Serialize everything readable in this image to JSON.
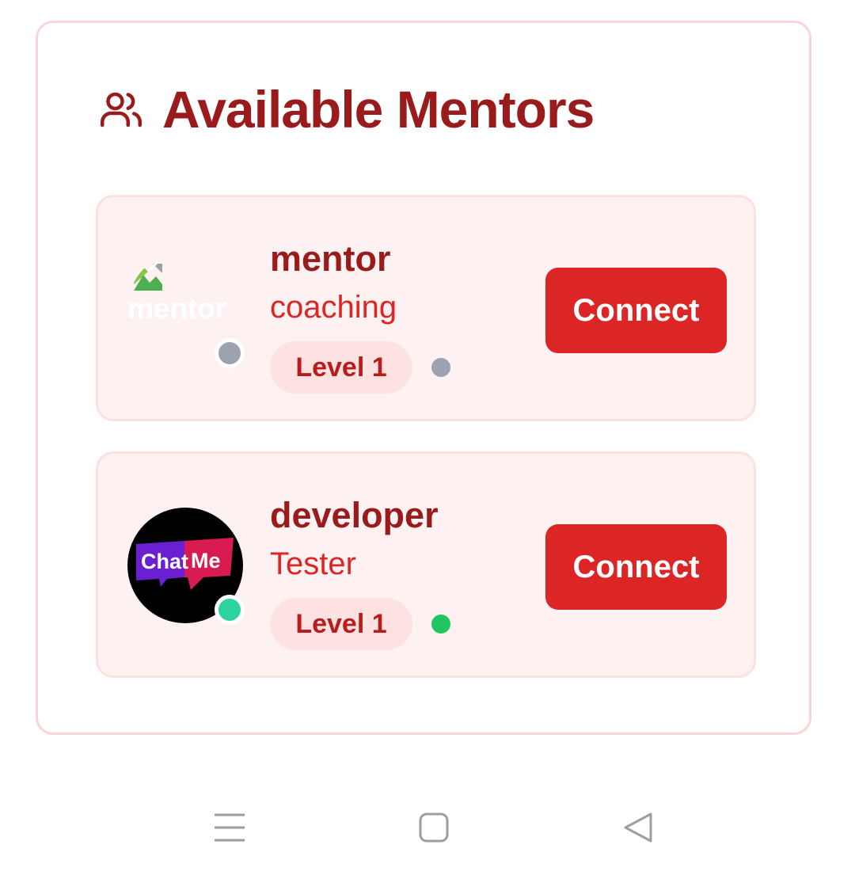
{
  "header": {
    "title": "Available Mentors",
    "icon": "users-icon"
  },
  "mentors": [
    {
      "name": "mentor",
      "role": "coaching",
      "level": "Level 1",
      "avatar_alt": "mentor",
      "avatar_type": "broken-image",
      "status": "offline",
      "status_color": "#9ca3af",
      "connect_label": "Connect"
    },
    {
      "name": "developer",
      "role": "Tester",
      "level": "Level 1",
      "avatar_logo_text": [
        "Chat",
        "Me"
      ],
      "avatar_type": "logo",
      "status": "online",
      "status_color": "#2dd4a0",
      "status_dot_color": "#22c55e",
      "connect_label": "Connect"
    }
  ],
  "colors": {
    "brand_dark": "#991b1b",
    "brand": "#dc2626",
    "card_bg": "#fef1f1",
    "badge_bg": "#fee2e2"
  },
  "system_nav": {
    "items": [
      "menu-icon",
      "home-icon",
      "back-icon"
    ]
  }
}
